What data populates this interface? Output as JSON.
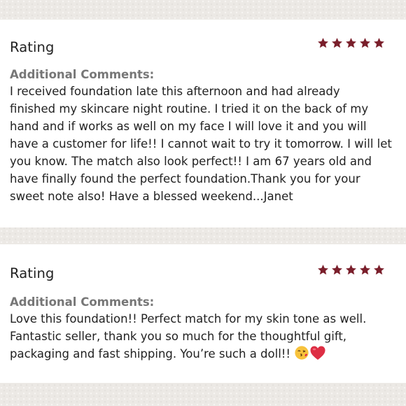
{
  "reviews": [
    {
      "rating_label": "Rating",
      "stars": 5,
      "comments_heading": "Additional Comments:",
      "comments_text": "I received foundation late this afternoon and had already\nfinished my skincare night routine. I tried it on the back of my\nhand and if works as well on my face I will love it and you will\nhave a customer for life!! I cannot wait to try it tomorrow. I will let\nyou know. The match also look perfect!! I am 67 years old and\nhave finally found the perfect foundation.Thank you for your\nsweet note also! Have a blessed weekend...Janet"
    },
    {
      "rating_label": "Rating",
      "stars": 5,
      "comments_heading": "Additional Comments:",
      "comments_text": "Love this foundation!! Perfect match for my skin tone as well.\nFantastic seller, thank you so much for the thoughtful gift,\npackaging and fast shipping. You’re such a doll!! ",
      "trailing_emojis": [
        "face-blowing-kiss-icon",
        "red-heart-icon"
      ]
    }
  ],
  "colors": {
    "star": "#7a1f2b",
    "heading": "#777777",
    "text": "#222222",
    "background": "#ece9e5",
    "card": "#ffffff"
  }
}
